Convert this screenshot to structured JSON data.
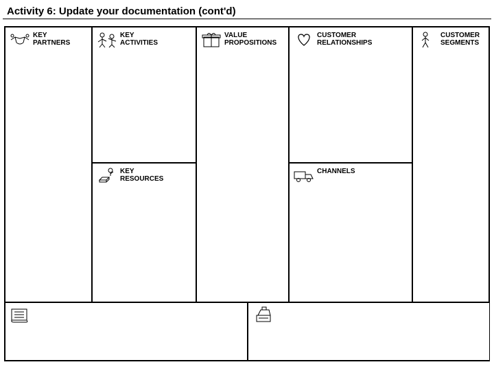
{
  "title": "Activity 6: Update your documentation (cont'd)",
  "cells": {
    "kp": "KEY\nPARTNERS",
    "ka": "KEY\nACTIVITIES",
    "kr": "KEY\nRESOURCES",
    "vp": "VALUE\nPROPOSITIONS",
    "cr": "CUSTOMER\nRELATIONSHIPS",
    "ch": "CHANNELS",
    "cs": "CUSTOMER\nSEGMENTS"
  }
}
